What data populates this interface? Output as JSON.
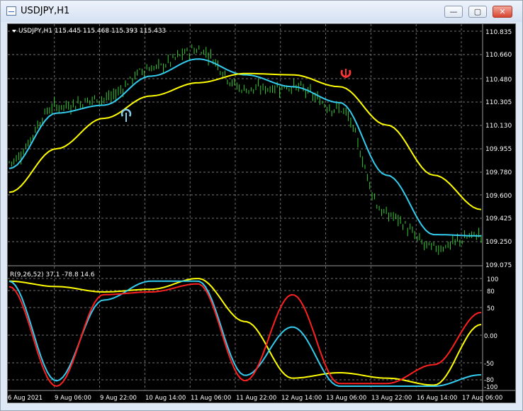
{
  "window": {
    "title": "USDJPY,H1",
    "buttons": {
      "minimize": "—",
      "restore": "▢",
      "close": "✕"
    }
  },
  "main_chart": {
    "header": "USDJPY,H1  115.445 115.468 115.393 115.433",
    "price_labels": [
      "110.835",
      "110.660",
      "110.480",
      "110.305",
      "110.130",
      "109.955",
      "109.780",
      "109.600",
      "109.425",
      "109.250",
      "109.075"
    ],
    "colors": {
      "background": "#000000",
      "candles": "#33cc33",
      "fast_ma": "#33ccee",
      "slow_ma": "#ffff00",
      "grid": "#9a9a9a",
      "buy_arrow": "#87ceeb",
      "sell_arrow": "#ff3333"
    }
  },
  "indicator": {
    "header": "R(9,26,52) 37.1 -78.8 14.6",
    "level_labels": [
      "100",
      "80",
      "50",
      "0.00",
      "-50",
      "-80",
      "-100"
    ],
    "colors": {
      "line1": "#ff2020",
      "line2": "#33ccee",
      "line3": "#ffff00"
    }
  },
  "time_labels": [
    "6 Aug 2021",
    "9 Aug 06:00",
    "9 Aug 22:00",
    "10 Aug 14:00",
    "11 Aug 06:00",
    "11 Aug 22:00",
    "12 Aug 14:00",
    "13 Aug 06:00",
    "13 Aug 22:00",
    "16 Aug 14:00",
    "17 Aug 06:00"
  ],
  "chart_data": [
    {
      "type": "line",
      "name": "USDJPY H1 price",
      "ylim": [
        109.075,
        110.835
      ],
      "close_x": [
        "6 Aug 2021",
        "9 Aug 06:00",
        "9 Aug 22:00",
        "10 Aug 14:00",
        "11 Aug 06:00",
        "11 Aug 22:00",
        "12 Aug 14:00",
        "13 Aug 06:00",
        "13 Aug 22:00",
        "16 Aug 14:00",
        "17 Aug 06:00"
      ],
      "close": [
        109.85,
        110.27,
        110.33,
        110.56,
        110.7,
        110.4,
        110.42,
        110.25,
        109.45,
        109.2,
        109.3
      ],
      "fast_ma": [
        109.8,
        110.22,
        110.28,
        110.5,
        110.63,
        110.51,
        110.42,
        110.3,
        109.75,
        109.3,
        109.29
      ],
      "slow_ma": [
        109.62,
        109.95,
        110.18,
        110.35,
        110.45,
        110.52,
        110.51,
        110.42,
        110.13,
        109.75,
        109.49
      ],
      "markers": [
        {
          "type": "buy",
          "at": "9 Aug 22:00"
        },
        {
          "type": "sell",
          "at": "13 Aug 06:00"
        }
      ]
    },
    {
      "type": "line",
      "name": "R(9,26,52)",
      "ylim": [
        -100,
        100
      ],
      "x": [
        "6 Aug 2021",
        "9 Aug 06:00",
        "9 Aug 22:00",
        "10 Aug 14:00",
        "11 Aug 06:00",
        "11 Aug 22:00",
        "12 Aug 14:00",
        "13 Aug 06:00",
        "13 Aug 22:00",
        "16 Aug 14:00",
        "17 Aug 06:00"
      ],
      "series": [
        {
          "values": [
            85,
            -100,
            70,
            75,
            90,
            -90,
            70,
            -95,
            -95,
            -60,
            37.1
          ]
        },
        {
          "values": [
            95,
            -90,
            60,
            95,
            95,
            -80,
            10,
            -100,
            -100,
            -100,
            -78.8
          ]
        },
        {
          "values": [
            95,
            85,
            75,
            80,
            100,
            20,
            -85,
            -75,
            -85,
            -98,
            14.6
          ]
        }
      ]
    }
  ]
}
